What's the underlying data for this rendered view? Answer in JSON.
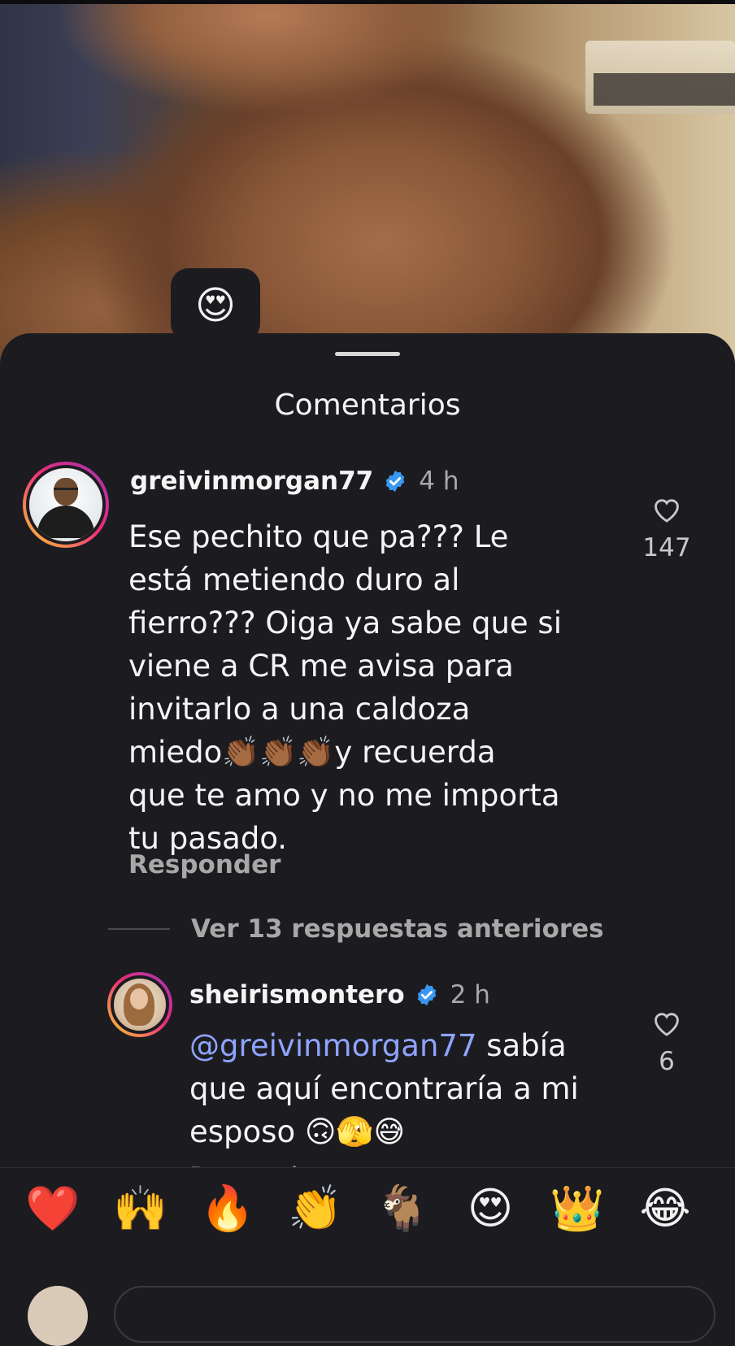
{
  "sheet": {
    "title": "Comentarios"
  },
  "post_reaction": {
    "emoji": "😍",
    "icon": "heart-eyes-emoji"
  },
  "comments": [
    {
      "username": "greivinmorgan77",
      "verified": true,
      "time": "4 h",
      "text": "Ese pechito que pa??? Le\nestá metiendo duro al\nfierro??? Oiga ya sabe que si\nviene a CR me avisa para\ninvitarlo a una caldoza\nmiedo👏🏾👏🏾👏🏾y recuerda\nque te amo y no me importa\ntu pasado.",
      "reply_label": "Responder",
      "likes": "147"
    }
  ],
  "replies": {
    "view_more_label": "Ver 13 respuestas anteriores",
    "items": [
      {
        "username": "sheirismontero",
        "verified": true,
        "time": "2 h",
        "mention": "@greivinmorgan77",
        "text": " sabía\nque aquí encontraría a mi\nesposo 🙃🫣😅",
        "reply_label": "Responder",
        "likes": "6"
      }
    ]
  },
  "emoji_bar": [
    "❤️",
    "🙌",
    "🔥",
    "👏",
    "🐐",
    "😍",
    "👑",
    "😂"
  ],
  "colors": {
    "background": "#1c1c20",
    "text": "#f5f5f5",
    "muted": "#a8a8a8",
    "mention": "#8fa4ff",
    "verified": "#3897f0"
  }
}
